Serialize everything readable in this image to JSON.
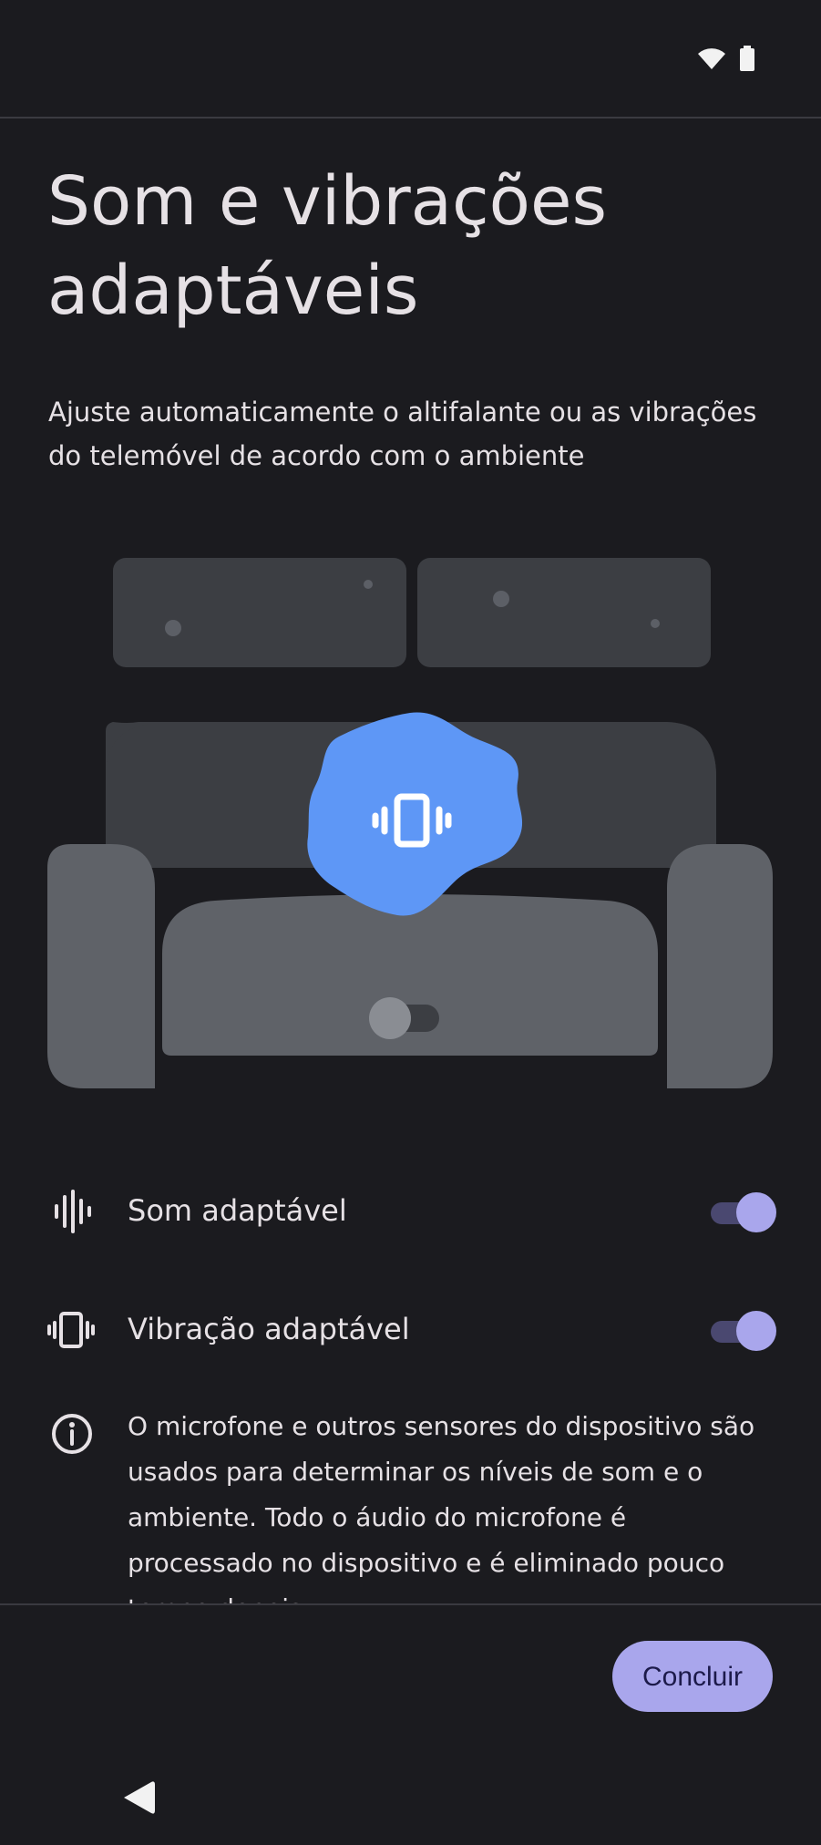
{
  "status_bar": {
    "icons": [
      "wifi-icon",
      "battery-icon"
    ]
  },
  "page": {
    "title": "Som e vibrações adaptáveis",
    "subtitle": "Ajuste automaticamente o altifalante ou as vibrações do telemóvel de acordo com o ambiente"
  },
  "settings": [
    {
      "label": "Som adaptável",
      "icon": "sound-wave-icon",
      "enabled": true
    },
    {
      "label": "Vibração adaptável",
      "icon": "vibration-icon",
      "enabled": true
    }
  ],
  "info": {
    "icon": "info-icon",
    "text": "O microfone e outros sensores do dispositivo são usados para determinar os níveis de som e o ambiente. Todo o áudio do microfone é processado no dispositivo e é eliminado pouco tempo depois."
  },
  "actions": {
    "done_label": "Concluir"
  },
  "navigation": {
    "back_icon": "back-triangle-icon"
  },
  "colors": {
    "background": "#1b1b1f",
    "accent": "#a9a6ec",
    "illustration_blue": "#5e97f6"
  }
}
